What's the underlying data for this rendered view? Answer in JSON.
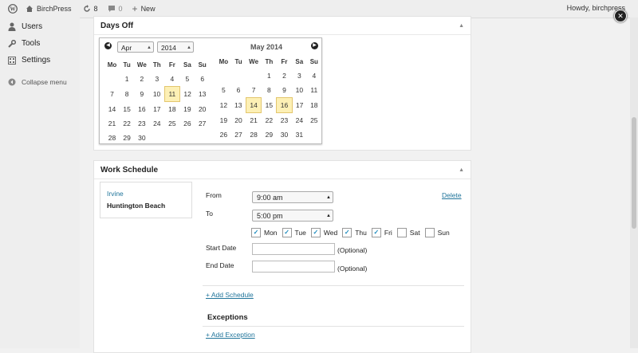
{
  "adminbar": {
    "site_name": "BirchPress",
    "updates_count": "8",
    "comments_count": "0",
    "new_label": "New",
    "greeting": "Howdy, birchpress"
  },
  "sidebar": {
    "items": [
      {
        "label": "Users",
        "icon": "users-icon"
      },
      {
        "label": "Tools",
        "icon": "wrench-icon"
      },
      {
        "label": "Settings",
        "icon": "settings-icon"
      }
    ],
    "collapse_label": "Collapse menu"
  },
  "days_off": {
    "title": "Days Off",
    "left": {
      "month_select": "Apr",
      "year_select": "2014",
      "weekdays": [
        "Mo",
        "Tu",
        "We",
        "Th",
        "Fr",
        "Sa",
        "Su"
      ],
      "rows": [
        [
          "",
          "1",
          "2",
          "3",
          "4",
          "5",
          "6"
        ],
        [
          "7",
          "8",
          "9",
          "10",
          "11",
          "12",
          "13"
        ],
        [
          "14",
          "15",
          "16",
          "17",
          "18",
          "19",
          "20"
        ],
        [
          "21",
          "22",
          "23",
          "24",
          "25",
          "26",
          "27"
        ],
        [
          "28",
          "29",
          "30",
          "",
          "",
          "",
          ""
        ]
      ],
      "highlighted": [
        "11"
      ]
    },
    "right": {
      "title": "May 2014",
      "weekdays": [
        "Mo",
        "Tu",
        "We",
        "Th",
        "Fr",
        "Sa",
        "Su"
      ],
      "rows": [
        [
          "",
          "",
          "",
          "1",
          "2",
          "3",
          "4"
        ],
        [
          "5",
          "6",
          "7",
          "8",
          "9",
          "10",
          "11"
        ],
        [
          "12",
          "13",
          "14",
          "15",
          "16",
          "17",
          "18"
        ],
        [
          "19",
          "20",
          "21",
          "22",
          "23",
          "24",
          "25"
        ],
        [
          "26",
          "27",
          "28",
          "29",
          "30",
          "31",
          ""
        ]
      ],
      "highlighted": [
        "14",
        "16"
      ]
    }
  },
  "work_schedule": {
    "title": "Work Schedule",
    "locations": [
      "Irvine",
      "Huntington Beach"
    ],
    "from_label": "From",
    "from_value": "9:00 am",
    "to_label": "To",
    "to_value": "5:00 pm",
    "delete_label": "Delete",
    "days": [
      {
        "label": "Mon",
        "checked": true
      },
      {
        "label": "Tue",
        "checked": true
      },
      {
        "label": "Wed",
        "checked": true
      },
      {
        "label": "Thu",
        "checked": true
      },
      {
        "label": "Fri",
        "checked": true
      },
      {
        "label": "Sat",
        "checked": false
      },
      {
        "label": "Sun",
        "checked": false
      }
    ],
    "start_date_label": "Start Date",
    "end_date_label": "End Date",
    "optional_label": "(Optional)",
    "add_schedule_label": "+ Add Schedule",
    "exceptions_label": "Exceptions",
    "add_exception_label": "+ Add Exception"
  }
}
